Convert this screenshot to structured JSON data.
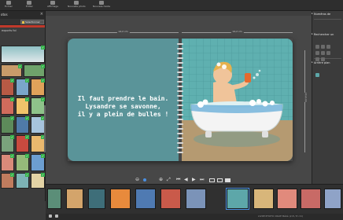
{
  "toolbar": {
    "items": [
      {
        "label": "Fichier"
      },
      {
        "label": "Éditer"
      },
      {
        "label": "Affichage"
      },
      {
        "label": "Nouvelle photo"
      },
      {
        "label": "Nouveau texte"
      }
    ]
  },
  "left_panel": {
    "title": "otos",
    "close": "×",
    "select_button": "Sélectionner",
    "section_label": "exports fol"
  },
  "workspace": {
    "width_label_left": "14,2 cm",
    "width_label_right": "14,2 cm",
    "height_label": "14,2 cm"
  },
  "book": {
    "left_text_line1": "Il faut prendre le bain.",
    "left_text_line2": "Lysandre se savonne,",
    "left_text_line3": "il y a plein de bulles !"
  },
  "right_panel": {
    "sections": [
      {
        "label": "Numéros de"
      },
      {
        "label": "Rechercher un"
      },
      {
        "label": "Arrière plan"
      }
    ]
  },
  "controls": {
    "zoom_out": "⊖",
    "zoom_in": "⊕",
    "fit": "⤢",
    "first": "⏮",
    "prev": "◀",
    "next": "▶",
    "last": "⏭"
  },
  "status": {
    "text": "LIVRE PHOTO CRAIE Bébé (2,8 / 8 cm)"
  },
  "colors": {
    "page_left": "#5a9499",
    "page_right": "#5da7a9",
    "check": "#35b14a",
    "accent_red": "#c0392b"
  }
}
